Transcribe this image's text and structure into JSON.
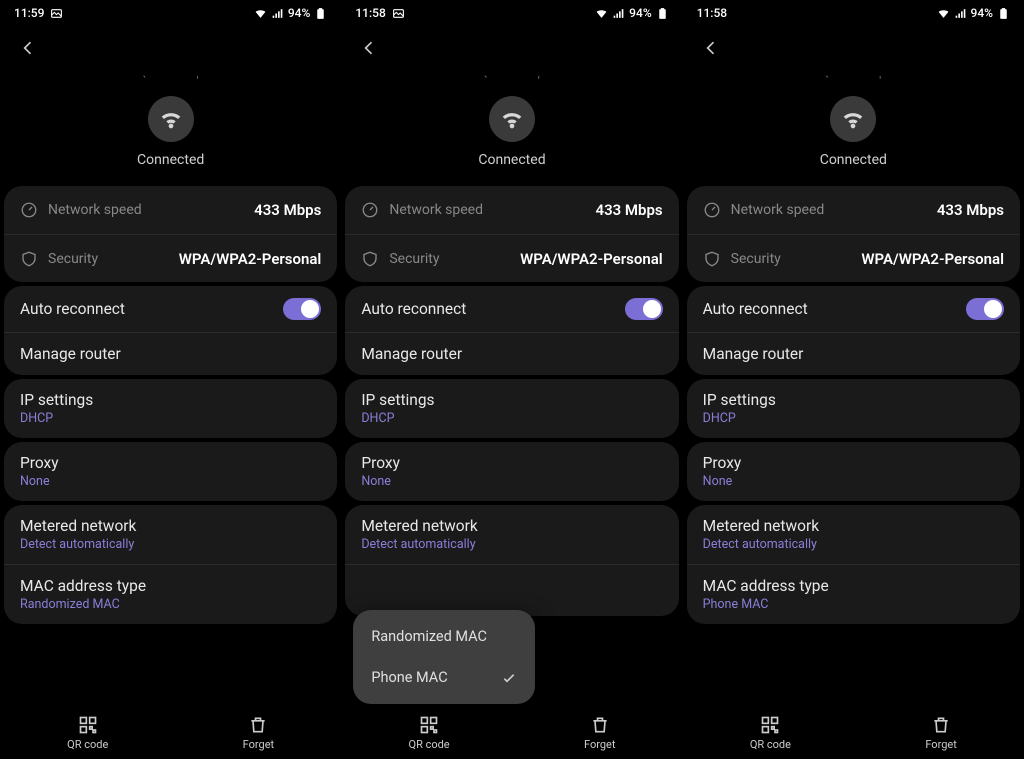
{
  "screens": [
    {
      "time": "11:59",
      "battery": "94%",
      "connected": "Connected",
      "speed_label": "Network speed",
      "speed_value": "433 Mbps",
      "security_label": "Security",
      "security_value": "WPA/WPA2-Personal",
      "auto_reconnect": "Auto reconnect",
      "manage_router": "Manage router",
      "ip_title": "IP settings",
      "ip_sub": "DHCP",
      "proxy_title": "Proxy",
      "proxy_sub": "None",
      "metered_title": "Metered network",
      "metered_sub": "Detect automatically",
      "mac_title": "MAC address type",
      "mac_sub": "Randomized MAC",
      "qr": "QR code",
      "forget": "Forget",
      "show_popup": false
    },
    {
      "time": "11:58",
      "battery": "94%",
      "connected": "Connected",
      "speed_label": "Network speed",
      "speed_value": "433 Mbps",
      "security_label": "Security",
      "security_value": "WPA/WPA2-Personal",
      "auto_reconnect": "Auto reconnect",
      "manage_router": "Manage router",
      "ip_title": "IP settings",
      "ip_sub": "DHCP",
      "proxy_title": "Proxy",
      "proxy_sub": "None",
      "metered_title": "Metered network",
      "metered_sub": "Detect automatically",
      "mac_title": "",
      "mac_sub": "",
      "qr": "QR code",
      "forget": "Forget",
      "show_popup": true,
      "popup_opt1": "Randomized MAC",
      "popup_opt2": "Phone MAC"
    },
    {
      "time": "11:58",
      "battery": "94%",
      "connected": "Connected",
      "speed_label": "Network speed",
      "speed_value": "433 Mbps",
      "security_label": "Security",
      "security_value": "WPA/WPA2-Personal",
      "auto_reconnect": "Auto reconnect",
      "manage_router": "Manage router",
      "ip_title": "IP settings",
      "ip_sub": "DHCP",
      "proxy_title": "Proxy",
      "proxy_sub": "None",
      "metered_title": "Metered network",
      "metered_sub": "Detect automatically",
      "mac_title": "MAC address type",
      "mac_sub": "Phone MAC",
      "qr": "QR code",
      "forget": "Forget",
      "show_popup": false
    }
  ]
}
